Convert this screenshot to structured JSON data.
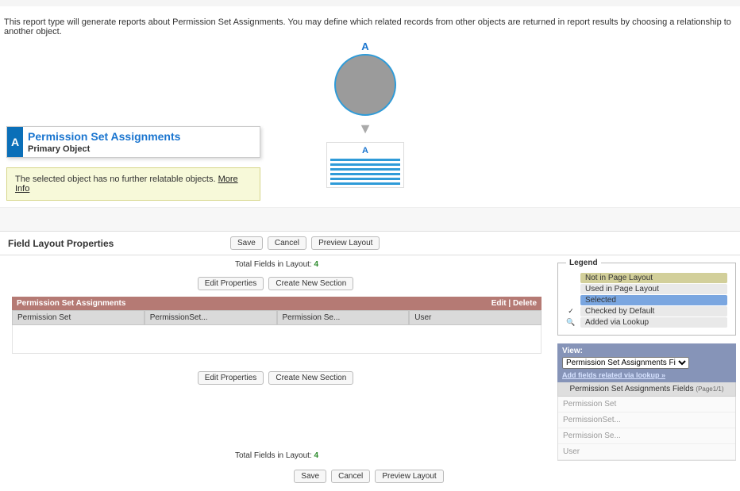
{
  "description": "This report type will generate reports about Permission Set Assignments. You may define which related records from other objects are returned in report results by choosing a relationship to another object.",
  "diagram_label": "A",
  "object_card": {
    "badge": "A",
    "title": "Permission Set Assignments",
    "subtitle": "Primary Object"
  },
  "note": {
    "text": "The selected object has no further relatable objects. ",
    "link": "More Info"
  },
  "section_title": "Field Layout Properties",
  "buttons": {
    "save": "Save",
    "cancel": "Cancel",
    "preview": "Preview Layout",
    "edit_props": "Edit Properties",
    "create_section": "Create New Section"
  },
  "totals": {
    "label": "Total Fields in Layout: ",
    "count": "4"
  },
  "psa": {
    "title": "Permission Set Assignments",
    "edit": "Edit",
    "delete": "Delete",
    "cols": [
      "Permission Set",
      "PermissionSet...",
      "Permission Se...",
      "User"
    ]
  },
  "legend": {
    "title": "Legend",
    "items": [
      {
        "label": "Not in Page Layout",
        "bg": "#d2cf9a"
      },
      {
        "label": "Used in Page Layout",
        "bg": "#e9e9e9"
      },
      {
        "label": "Selected",
        "bg": "#7aa6e0"
      },
      {
        "label": "Checked by Default",
        "bg": "#e9e9e9",
        "icon": "✓"
      },
      {
        "label": "Added via Lookup",
        "bg": "#e9e9e9",
        "icon": "🔍"
      }
    ]
  },
  "view": {
    "label": "View:",
    "selected": "Permission Set Assignments Fields",
    "link": "Add fields related via lookup »",
    "subtitle": "Permission Set Assignments Fields",
    "page": "(Page1/1)",
    "items": [
      "Permission Set",
      "PermissionSet...",
      "Permission Se...",
      "User"
    ]
  }
}
